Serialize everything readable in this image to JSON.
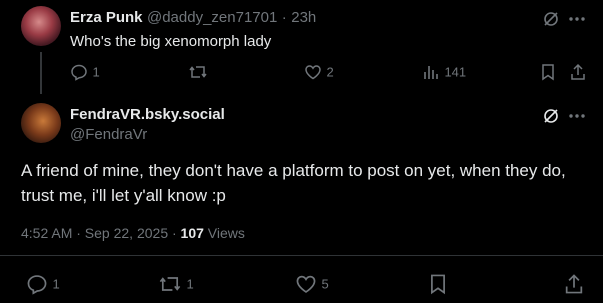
{
  "reply": {
    "display_name": "Erza Punk",
    "handle": "@daddy_zen71701",
    "separator": "·",
    "time": "23h",
    "text": "Who's the big xenomorph lady",
    "stats": {
      "replies": "1",
      "likes": "2",
      "views": "141"
    }
  },
  "post": {
    "display_name": "FendraVR.bsky.social",
    "handle": "@FendraVr",
    "text_line1": "A friend of mine, they don't have a platform to post on yet, when they do,",
    "text_line2": "trust me, i'll let y'all know :p",
    "timestamp": "4:52 AM · Sep 22, 2025 ·",
    "views_count": "107",
    "views_label": "Views",
    "stats": {
      "replies": "1",
      "reposts": "1",
      "likes": "5"
    }
  },
  "icons": {
    "grok": "grok-icon",
    "more": "more-icon",
    "reply": "reply-icon",
    "repost": "repost-icon",
    "like": "like-icon",
    "views": "views-icon",
    "bookmark": "bookmark-icon",
    "share": "share-icon"
  },
  "colors": {
    "background": "#000000",
    "text": "#e7e9ea",
    "muted": "#71767b",
    "divider": "#2f3336"
  }
}
